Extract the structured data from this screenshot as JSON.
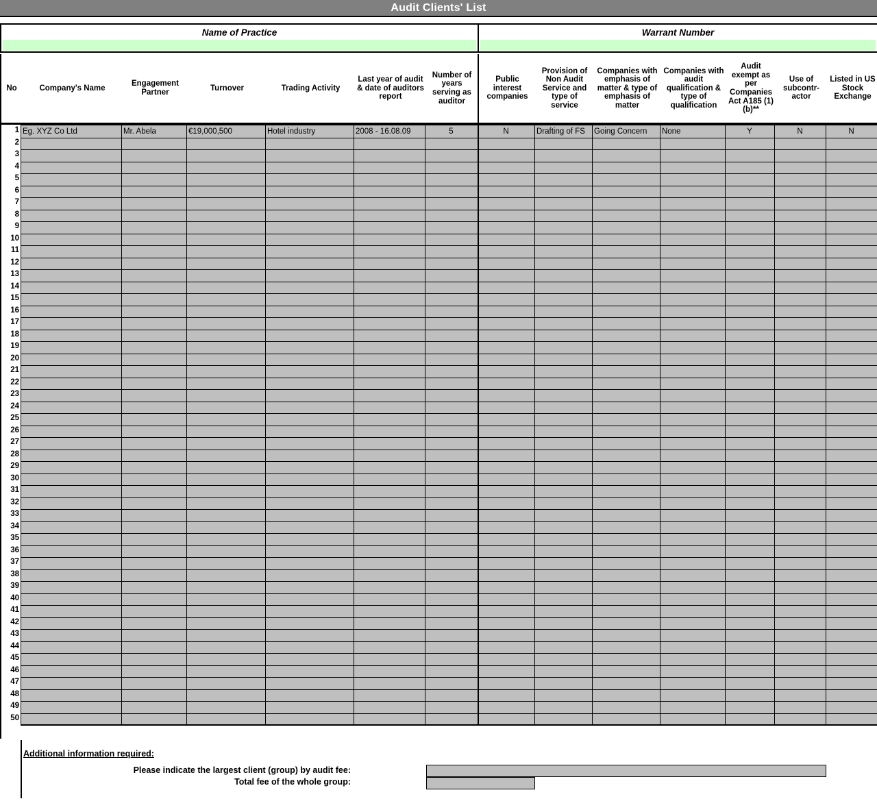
{
  "title": "Audit Clients' List",
  "practice_section": {
    "name_of_practice_label": "Name of Practice",
    "name_of_practice_value": "",
    "warrant_number_label": "Warrant Number",
    "warrant_number_value": ""
  },
  "table": {
    "columns": [
      {
        "label": "No",
        "align": "ctr"
      },
      {
        "label": "Company's Name",
        "align": "lft"
      },
      {
        "label": "Engagement Partner",
        "align": "lft"
      },
      {
        "label": "Turnover",
        "align": "lft"
      },
      {
        "label": "Trading Activity",
        "align": "lft"
      },
      {
        "label": "Last year of audit & date of auditors report",
        "align": "lft"
      },
      {
        "label": "Number of years serving as auditor",
        "align": "ctr"
      },
      {
        "label": "Public interest companies",
        "align": "ctr"
      },
      {
        "label": "Provision of Non Audit Service and type of service",
        "align": "lft"
      },
      {
        "label": "Companies with emphasis of matter & type of emphasis of matter",
        "align": "lft"
      },
      {
        "label": "Companies with audit qualification & type of qualification",
        "align": "lft"
      },
      {
        "label": "Audit exempt as per Companies Act A185 (1) (b)**",
        "align": "ctr"
      },
      {
        "label": "Use of subcontr-actor",
        "align": "ctr"
      },
      {
        "label": "Listed in US Stock Exchange",
        "align": "ctr"
      }
    ],
    "row_count": 50,
    "rows": [
      {
        "no": "1",
        "company_name": "Eg.  XYZ Co Ltd",
        "engagement_partner": "Mr. Abela",
        "turnover": "€19,000,500",
        "trading_activity": "Hotel industry",
        "last_year_audit": "2008 - 16.08.09",
        "years_serving": "5",
        "public_interest": "N",
        "non_audit_service": "Drafting of FS",
        "emphasis_of_matter": "Going Concern",
        "audit_qualification": "None",
        "audit_exempt": "Y",
        "subcontractor": "N",
        "us_listed": "N"
      }
    ]
  },
  "footer": {
    "additional_info_title": "Additional information required:",
    "largest_client_label": "Please indicate the largest client (group) by audit fee:",
    "largest_client_value": "",
    "total_fee_label": "Total fee of the whole group:",
    "total_fee_value": ""
  },
  "colors": {
    "title_bar": "#808080",
    "input_green": "#CCFFCC",
    "cell_gray": "#BFBFBF",
    "border": "#000000"
  }
}
